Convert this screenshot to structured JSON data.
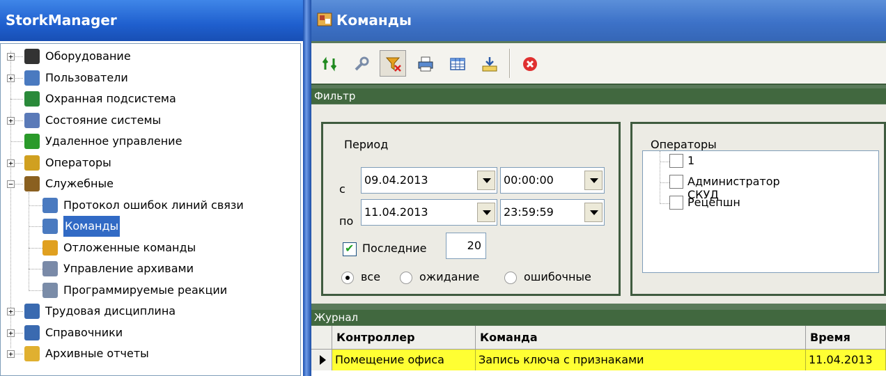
{
  "left_panel": {
    "title": "StorkManager",
    "tree": [
      {
        "label": "Оборудование",
        "icon": "equipment-icon",
        "expander": "+"
      },
      {
        "label": "Пользователи",
        "icon": "users-icon",
        "expander": "+"
      },
      {
        "label": "Охранная подсистема",
        "icon": "security-subsystem-icon",
        "expander": ""
      },
      {
        "label": "Состояние системы",
        "icon": "system-state-icon",
        "expander": "+"
      },
      {
        "label": "Удаленное управление",
        "icon": "remote-control-icon",
        "expander": ""
      },
      {
        "label": "Операторы",
        "icon": "operators-icon",
        "expander": "+"
      },
      {
        "label": "Служебные",
        "icon": "service-icon",
        "expander": "−"
      },
      {
        "label": "Протокол ошибок линий связи",
        "icon": "error-log-icon",
        "expander": ""
      },
      {
        "label": "Команды",
        "icon": "commands-icon",
        "expander": "",
        "selected": true
      },
      {
        "label": "Отложенные команды",
        "icon": "deferred-commands-icon",
        "expander": ""
      },
      {
        "label": "Управление архивами",
        "icon": "archive-management-icon",
        "expander": ""
      },
      {
        "label": "Программируемые реакции",
        "icon": "programmable-reactions-icon",
        "expander": ""
      },
      {
        "label": "Трудовая дисциплина",
        "icon": "labor-discipline-icon",
        "expander": "+"
      },
      {
        "label": "Справочники",
        "icon": "reference-books-icon",
        "expander": "+"
      },
      {
        "label": "Архивные отчеты",
        "icon": "archive-reports-icon",
        "expander": "+"
      }
    ]
  },
  "right_panel": {
    "title": "Команды",
    "toolbar": [
      {
        "name": "refresh-button",
        "icon": "refresh-icon"
      },
      {
        "name": "settings-button",
        "icon": "wrench-icon"
      },
      {
        "name": "filter-button",
        "icon": "filter-icon",
        "pressed": true
      },
      {
        "name": "print-button",
        "icon": "printer-icon"
      },
      {
        "name": "table-button",
        "icon": "table-icon"
      },
      {
        "name": "export-button",
        "icon": "export-icon"
      },
      {
        "name": "close-button",
        "icon": "close-icon"
      }
    ],
    "filter": {
      "header": "Фильтр",
      "period": {
        "label": "Период",
        "from_label": "с",
        "to_label": "по",
        "from_date": "09.04.2013",
        "from_time": "00:00:00",
        "to_date": "11.04.2013",
        "to_time": "23:59:59"
      },
      "last": {
        "label": "Последние",
        "checked": true,
        "value": "20"
      },
      "status_options": [
        {
          "label": "все",
          "checked": true
        },
        {
          "label": "ожидание",
          "checked": false
        },
        {
          "label": "ошибочные",
          "checked": false
        }
      ],
      "operators": {
        "label": "Операторы",
        "items": [
          "1",
          "Администратор СКУД",
          "Рецепшн"
        ]
      }
    },
    "journal": {
      "header": "Журнал",
      "columns": [
        "Контроллер",
        "Команда",
        "Время"
      ],
      "rows": [
        [
          "Помещение офиса",
          "Запись ключа с признаками",
          "11.04.2013"
        ]
      ],
      "highlight_color": "#ffff33"
    }
  }
}
